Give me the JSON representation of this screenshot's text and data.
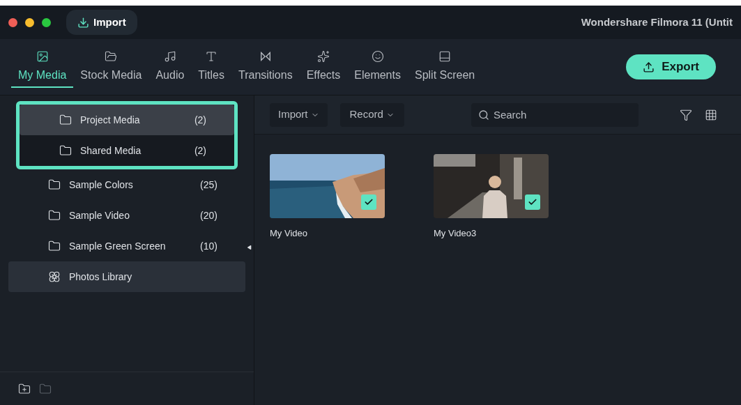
{
  "window": {
    "title": "Wondershare Filmora 11 (Untit",
    "import_button": "Import"
  },
  "tabs": [
    {
      "label": "My Media",
      "selected": true
    },
    {
      "label": "Stock Media",
      "selected": false
    },
    {
      "label": "Audio",
      "selected": false
    },
    {
      "label": "Titles",
      "selected": false
    },
    {
      "label": "Transitions",
      "selected": false
    },
    {
      "label": "Effects",
      "selected": false
    },
    {
      "label": "Elements",
      "selected": false
    },
    {
      "label": "Split Screen",
      "selected": false
    }
  ],
  "export_button": "Export",
  "sidebar": {
    "items": [
      {
        "label": "Project Media",
        "count": "(2)",
        "kind": "folder",
        "selected": true,
        "hovered": false,
        "highlighted": true
      },
      {
        "label": "Shared Media",
        "count": "(2)",
        "kind": "folder",
        "selected": false,
        "hovered": false,
        "highlighted": true
      },
      {
        "label": "Sample Colors",
        "count": "(25)",
        "kind": "folder",
        "selected": false,
        "hovered": false,
        "highlighted": false
      },
      {
        "label": "Sample Video",
        "count": "(20)",
        "kind": "folder",
        "selected": false,
        "hovered": false,
        "highlighted": false
      },
      {
        "label": "Sample Green Screen",
        "count": "(10)",
        "kind": "folder",
        "selected": false,
        "hovered": false,
        "highlighted": false
      },
      {
        "label": "Photos Library",
        "kind": "library",
        "selected": false,
        "hovered": true,
        "highlighted": false
      }
    ]
  },
  "media_toolbar": {
    "import": "Import",
    "record": "Record",
    "search": {
      "placeholder": "Search"
    }
  },
  "media": [
    {
      "name": "My Video",
      "kind": "sea",
      "checked": true
    },
    {
      "name": "My Video3",
      "kind": "street",
      "checked": true
    }
  ]
}
